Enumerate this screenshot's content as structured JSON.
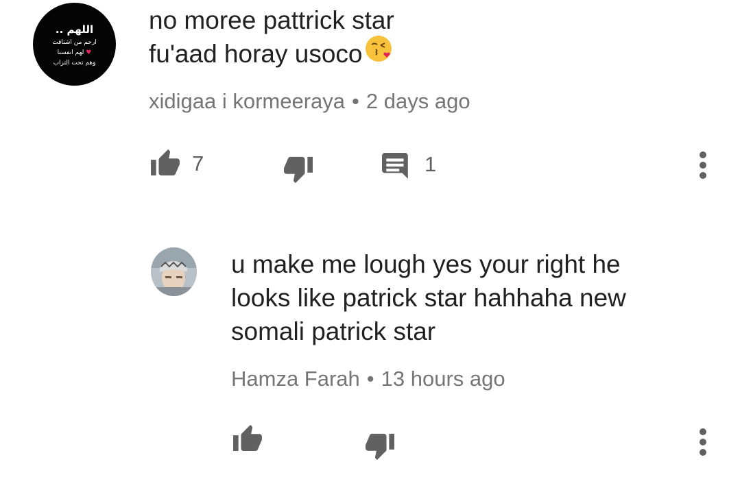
{
  "comment": {
    "text_lines": [
      "no moree pattrick star",
      "fu'aad horay usoco"
    ],
    "emoji": "kissing-face-emoji",
    "author": "xidigaa i kormeeraya",
    "separator": "•",
    "time": "2 days ago",
    "like_count": "7",
    "reply_count": "1",
    "avatar_text_lines": [
      "اللهم ..",
      "ارحم من اشتاقت",
      "لهم انفسنا",
      "وهم تحت التراب"
    ]
  },
  "reply": {
    "text_lines": [
      "u make me lough yes your right he",
      "looks like patrick star hahhaha new",
      "somali patrick star"
    ],
    "author": "Hamza Farah",
    "separator": "•",
    "time": "13 hours ago"
  },
  "icons": {
    "like": "thumbs-up-icon",
    "dislike": "thumbs-down-icon",
    "reply": "comment-icon",
    "more": "more-vertical-icon"
  },
  "colors": {
    "text": "#212121",
    "meta": "#757575",
    "icon": "#616161",
    "avatar_bg": "#050505",
    "avatar_accent": "#e0245e"
  }
}
